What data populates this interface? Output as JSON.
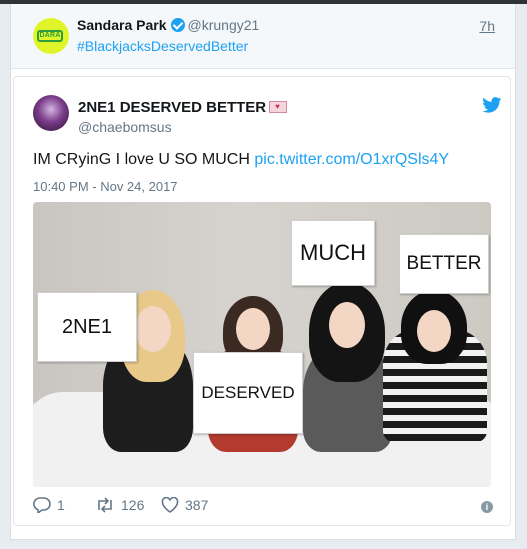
{
  "reply": {
    "name": "Sandara Park",
    "handle": "@krungy21",
    "time": "7h",
    "text": "#BlackjacksDeservedBetter",
    "avatar_logo_text": "DARA"
  },
  "quoted": {
    "name": "2NE1 DESERVED BETTER",
    "handle": "@chaebomsus",
    "text": "IM CRyinG I love U SO MUCH ",
    "link": "pic.twitter.com/O1xrQSls4Y",
    "date": "10:40 PM - Nov 24, 2017"
  },
  "photo_signs": {
    "sign1": "2NE1",
    "sign2": "DESERVED",
    "sign3": "MUCH",
    "sign4": "BETTER"
  },
  "actions": {
    "replies": "1",
    "retweets": "126",
    "likes": "387"
  },
  "colors": {
    "accent": "#1da1f2",
    "muted": "#657786",
    "background": "#e6ecf0"
  },
  "icons": [
    "verified-badge-icon",
    "envelope-heart-emoji-icon",
    "twitter-bird-icon",
    "reply-icon",
    "retweet-icon",
    "like-icon",
    "info-icon"
  ]
}
